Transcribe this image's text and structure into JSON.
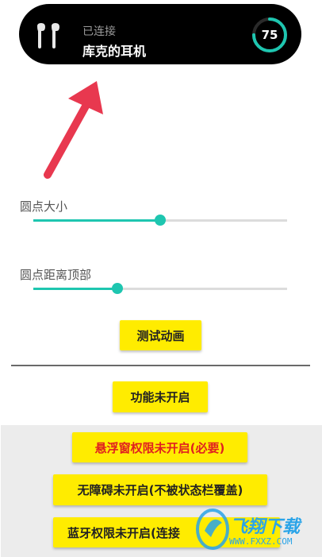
{
  "island": {
    "status": "已连接",
    "device_name": "库克的耳机",
    "battery_percent": 75,
    "battery_text": "75",
    "accent_color": "#1ec6b0",
    "icon": "airpods-icon"
  },
  "sliders": [
    {
      "label": "圆点大小",
      "value_fraction": 0.5
    },
    {
      "label": "圆点距离顶部",
      "value_fraction": 0.33
    }
  ],
  "buttons": {
    "test_animation": "测试动画",
    "feature_status": "功能未开启",
    "overlay_permission": "悬浮窗权限未开启(必要)",
    "accessibility": "无障碍未开启(不被状态栏覆盖)",
    "bluetooth_permission": "蓝牙权限未开启(连接"
  },
  "watermark": {
    "site_name": "飞翔下载",
    "site_url": "WWW.FXXZ.COM"
  }
}
